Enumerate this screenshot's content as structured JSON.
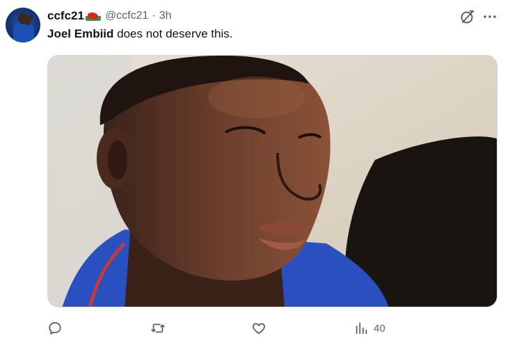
{
  "tweet": {
    "display_name": "ccfc21",
    "handle": "@ccfc21",
    "separator": "·",
    "time": "3h",
    "text_mention": "Joel Embiid",
    "text_rest": " does not deserve this.",
    "avatar": {
      "icon": "avatar-player-photo"
    },
    "flag": {
      "icon": "wales-flag-emoji"
    }
  },
  "header_icons": {
    "grok": "grok-icon",
    "more": "more-icon"
  },
  "media": {
    "kind": "photo"
  },
  "actions": {
    "reply": {
      "icon": "reply-icon",
      "count": ""
    },
    "retweet": {
      "icon": "retweet-icon",
      "count": ""
    },
    "like": {
      "icon": "like-icon",
      "count": ""
    },
    "views": {
      "icon": "views-icon",
      "count": "40"
    }
  },
  "colors": {
    "text_primary": "#0f1419",
    "text_secondary": "#536471",
    "border": "#cfd9de"
  }
}
